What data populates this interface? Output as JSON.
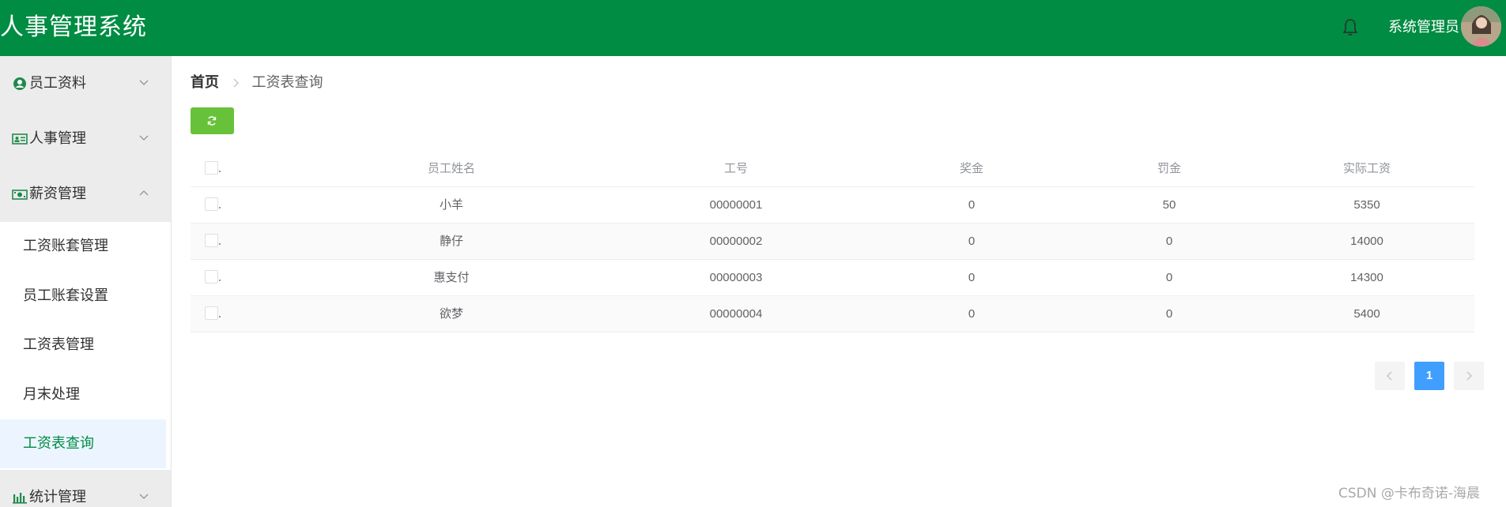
{
  "header": {
    "app_title": "人事管理系统",
    "user_name": "系统管理员",
    "bg_color": "#008c43"
  },
  "sidebar": {
    "groups": [
      {
        "label": "员工资料",
        "icon": "user-circle-icon",
        "expanded": false
      },
      {
        "label": "人事管理",
        "icon": "id-card-icon",
        "expanded": false
      },
      {
        "label": "薪资管理",
        "icon": "money-icon",
        "expanded": true
      },
      {
        "label": "统计管理",
        "icon": "bar-chart-icon",
        "expanded": false
      }
    ],
    "salary_items": [
      {
        "label": "工资账套管理",
        "active": false
      },
      {
        "label": "员工账套设置",
        "active": false
      },
      {
        "label": "工资表管理",
        "active": false
      },
      {
        "label": "月末处理",
        "active": false
      },
      {
        "label": "工资表查询",
        "active": true
      }
    ]
  },
  "breadcrumb": {
    "home": "首页",
    "current": "工资表查询"
  },
  "table": {
    "headers": {
      "name": "员工姓名",
      "work_no": "工号",
      "bonus": "奖金",
      "fine": "罚金",
      "actual": "实际工资"
    },
    "rows": [
      {
        "name": "小羊",
        "work_no": "00000001",
        "bonus": "0",
        "fine": "50",
        "actual": "5350"
      },
      {
        "name": "静仔",
        "work_no": "00000002",
        "bonus": "0",
        "fine": "0",
        "actual": "14000"
      },
      {
        "name": "惠支付",
        "work_no": "00000003",
        "bonus": "0",
        "fine": "0",
        "actual": "14300"
      },
      {
        "name": "欲梦",
        "work_no": "00000004",
        "bonus": "0",
        "fine": "0",
        "actual": "5400"
      }
    ]
  },
  "pagination": {
    "current_page": "1"
  },
  "watermark": "CSDN @卡布奇诺-海晨",
  "colors": {
    "accent": "#008c43",
    "refresh_button": "#67c23a",
    "active_page": "#409eff"
  }
}
